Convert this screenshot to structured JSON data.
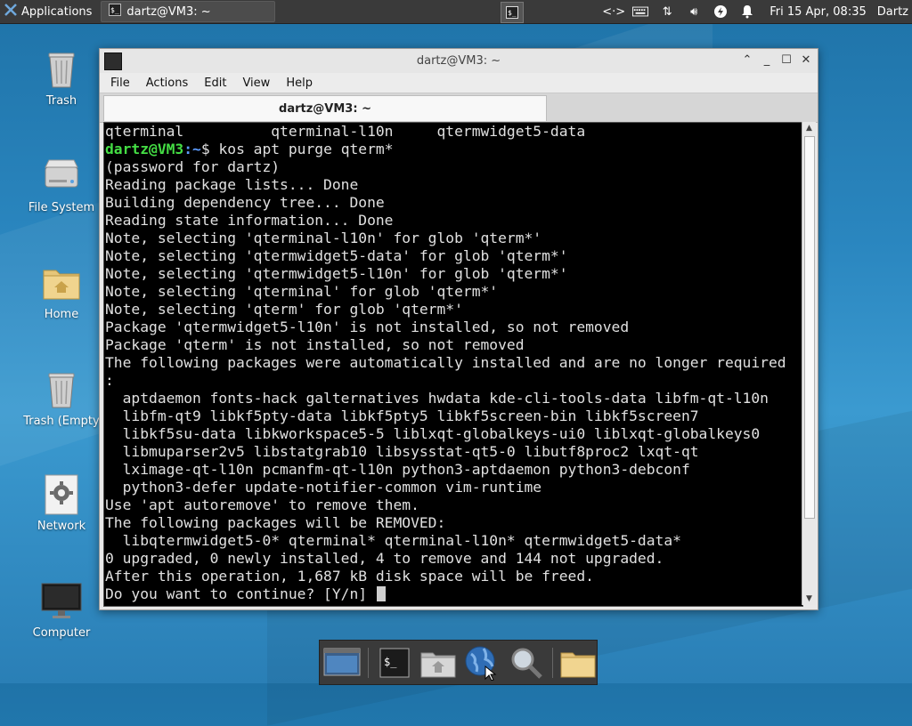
{
  "panel": {
    "apps_label": "Applications",
    "task_label": "dartz@VM3: ~",
    "clock": "Fri 15 Apr, 08:35",
    "user": "Dartz",
    "tray_icons": [
      "network-icon",
      "keyboard-icon",
      "transfer-icon",
      "volume-icon",
      "power-icon",
      "notifications-icon"
    ]
  },
  "desktop": {
    "icons": [
      {
        "label": "Trash",
        "icon": "trash-icon"
      },
      {
        "label": "File System",
        "icon": "drive-icon"
      },
      {
        "label": "Home",
        "icon": "home-folder-icon"
      },
      {
        "label": "Trash (Empty",
        "icon": "trash-icon"
      },
      {
        "label": "Network",
        "icon": "network-settings-icon"
      },
      {
        "label": "Computer",
        "icon": "monitor-icon"
      }
    ]
  },
  "window": {
    "title": "dartz@VM3: ~",
    "menu": [
      "File",
      "Actions",
      "Edit",
      "View",
      "Help"
    ],
    "tab_label": "dartz@VM3: ~"
  },
  "terminal": {
    "prompt_user": "dartz@VM3",
    "prompt_path": ":~",
    "prompt_symbol": "$",
    "command": " kos apt purge qterm*",
    "lines_before": [
      "qterminal          qterminal-l10n     qtermwidget5-data"
    ],
    "lines_after": [
      "(password for dartz)",
      "Reading package lists... Done",
      "Building dependency tree... Done",
      "Reading state information... Done",
      "Note, selecting 'qterminal-l10n' for glob 'qterm*'",
      "Note, selecting 'qtermwidget5-data' for glob 'qterm*'",
      "Note, selecting 'qtermwidget5-l10n' for glob 'qterm*'",
      "Note, selecting 'qterminal' for glob 'qterm*'",
      "Note, selecting 'qterm' for glob 'qterm*'",
      "Package 'qtermwidget5-l10n' is not installed, so not removed",
      "Package 'qterm' is not installed, so not removed",
      "The following packages were automatically installed and are no longer required",
      ":",
      "  aptdaemon fonts-hack galternatives hwdata kde-cli-tools-data libfm-qt-l10n",
      "  libfm-qt9 libkf5pty-data libkf5pty5 libkf5screen-bin libkf5screen7",
      "  libkf5su-data libkworkspace5-5 liblxqt-globalkeys-ui0 liblxqt-globalkeys0",
      "  libmuparser2v5 libstatgrab10 libsysstat-qt5-0 libutf8proc2 lxqt-qt",
      "  lximage-qt-l10n pcmanfm-qt-l10n python3-aptdaemon python3-debconf",
      "  python3-defer update-notifier-common vim-runtime",
      "Use 'apt autoremove' to remove them.",
      "The following packages will be REMOVED:",
      "  libqtermwidget5-0* qterminal* qterminal-l10n* qtermwidget5-data*",
      "0 upgraded, 0 newly installed, 4 to remove and 144 not upgraded.",
      "After this operation, 1,687 kB disk space will be freed."
    ],
    "last_line": "Do you want to continue? [Y/n] "
  },
  "dock": {
    "items": [
      "show-desktop-icon",
      "terminal-icon",
      "home-folder-icon",
      "web-browser-icon",
      "search-icon",
      "folder-icon"
    ]
  }
}
